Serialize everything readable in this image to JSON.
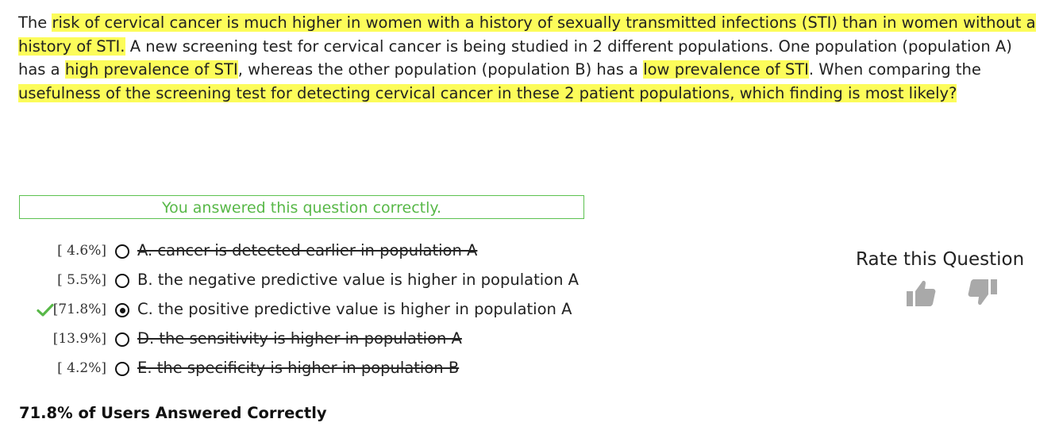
{
  "question": {
    "segments": [
      {
        "text": "The ",
        "hl": false
      },
      {
        "text": "risk of cervical cancer is much higher in women with a history of sexually transmitted infections (STI) than in women without a history of STI.",
        "hl": true
      },
      {
        "text": " A new screening test for cervical cancer is being studied in 2 different populations. One population (population A) has a ",
        "hl": false
      },
      {
        "text": "high prevalence of STI",
        "hl": true
      },
      {
        "text": ", whereas the other population (population B) has a ",
        "hl": false
      },
      {
        "text": "low prevalence of STI",
        "hl": true
      },
      {
        "text": ". When comparing the ",
        "hl": false
      },
      {
        "text": "usefulness of the screening test for detecting cervical cancer in these 2 patient populations, which finding is most likely?",
        "hl": true
      }
    ]
  },
  "result_banner": "You answered this question correctly.",
  "choices": [
    {
      "percent": "[ 4.6%]",
      "text": "A. cancer is detected earlier in population A",
      "struck": true,
      "selected": false,
      "correct": false
    },
    {
      "percent": "[ 5.5%]",
      "text": "B. the negative predictive value is higher in population A",
      "struck": false,
      "selected": false,
      "correct": false
    },
    {
      "percent": "[71.8%]",
      "text": "C. the positive predictive value is higher in population A",
      "struck": false,
      "selected": true,
      "correct": true
    },
    {
      "percent": "[13.9%]",
      "text": "D. the sensitivity is higher in population A",
      "struck": true,
      "selected": false,
      "correct": false
    },
    {
      "percent": "[ 4.2%]",
      "text": "E. the specificity is higher in population B",
      "struck": true,
      "selected": false,
      "correct": false
    }
  ],
  "summary": "71.8% of Users Answered Correctly",
  "rating": {
    "title": "Rate this Question",
    "up_icon": "thumbs-up-icon",
    "down_icon": "thumbs-down-icon"
  },
  "colors": {
    "highlight": "#fcfc5a",
    "correct_green": "#58b848",
    "icon_gray": "#a9a9a9"
  }
}
